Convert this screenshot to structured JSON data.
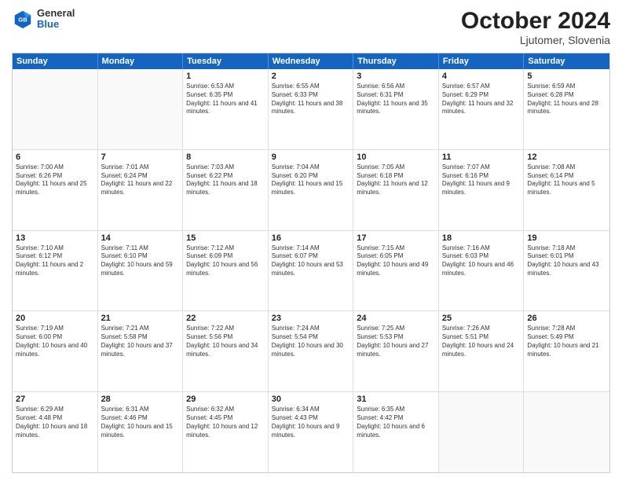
{
  "logo": {
    "general": "General",
    "blue": "Blue"
  },
  "header": {
    "month": "October 2024",
    "location": "Ljutomer, Slovenia"
  },
  "weekdays": [
    "Sunday",
    "Monday",
    "Tuesday",
    "Wednesday",
    "Thursday",
    "Friday",
    "Saturday"
  ],
  "rows": [
    [
      {
        "day": "",
        "sunrise": "",
        "sunset": "",
        "daylight": "",
        "empty": true
      },
      {
        "day": "",
        "sunrise": "",
        "sunset": "",
        "daylight": "",
        "empty": true
      },
      {
        "day": "1",
        "sunrise": "Sunrise: 6:53 AM",
        "sunset": "Sunset: 6:35 PM",
        "daylight": "Daylight: 11 hours and 41 minutes."
      },
      {
        "day": "2",
        "sunrise": "Sunrise: 6:55 AM",
        "sunset": "Sunset: 6:33 PM",
        "daylight": "Daylight: 11 hours and 38 minutes."
      },
      {
        "day": "3",
        "sunrise": "Sunrise: 6:56 AM",
        "sunset": "Sunset: 6:31 PM",
        "daylight": "Daylight: 11 hours and 35 minutes."
      },
      {
        "day": "4",
        "sunrise": "Sunrise: 6:57 AM",
        "sunset": "Sunset: 6:29 PM",
        "daylight": "Daylight: 11 hours and 32 minutes."
      },
      {
        "day": "5",
        "sunrise": "Sunrise: 6:59 AM",
        "sunset": "Sunset: 6:28 PM",
        "daylight": "Daylight: 11 hours and 28 minutes."
      }
    ],
    [
      {
        "day": "6",
        "sunrise": "Sunrise: 7:00 AM",
        "sunset": "Sunset: 6:26 PM",
        "daylight": "Daylight: 11 hours and 25 minutes."
      },
      {
        "day": "7",
        "sunrise": "Sunrise: 7:01 AM",
        "sunset": "Sunset: 6:24 PM",
        "daylight": "Daylight: 11 hours and 22 minutes."
      },
      {
        "day": "8",
        "sunrise": "Sunrise: 7:03 AM",
        "sunset": "Sunset: 6:22 PM",
        "daylight": "Daylight: 11 hours and 18 minutes."
      },
      {
        "day": "9",
        "sunrise": "Sunrise: 7:04 AM",
        "sunset": "Sunset: 6:20 PM",
        "daylight": "Daylight: 11 hours and 15 minutes."
      },
      {
        "day": "10",
        "sunrise": "Sunrise: 7:05 AM",
        "sunset": "Sunset: 6:18 PM",
        "daylight": "Daylight: 11 hours and 12 minutes."
      },
      {
        "day": "11",
        "sunrise": "Sunrise: 7:07 AM",
        "sunset": "Sunset: 6:16 PM",
        "daylight": "Daylight: 11 hours and 9 minutes."
      },
      {
        "day": "12",
        "sunrise": "Sunrise: 7:08 AM",
        "sunset": "Sunset: 6:14 PM",
        "daylight": "Daylight: 11 hours and 5 minutes."
      }
    ],
    [
      {
        "day": "13",
        "sunrise": "Sunrise: 7:10 AM",
        "sunset": "Sunset: 6:12 PM",
        "daylight": "Daylight: 11 hours and 2 minutes."
      },
      {
        "day": "14",
        "sunrise": "Sunrise: 7:11 AM",
        "sunset": "Sunset: 6:10 PM",
        "daylight": "Daylight: 10 hours and 59 minutes."
      },
      {
        "day": "15",
        "sunrise": "Sunrise: 7:12 AM",
        "sunset": "Sunset: 6:09 PM",
        "daylight": "Daylight: 10 hours and 56 minutes."
      },
      {
        "day": "16",
        "sunrise": "Sunrise: 7:14 AM",
        "sunset": "Sunset: 6:07 PM",
        "daylight": "Daylight: 10 hours and 53 minutes."
      },
      {
        "day": "17",
        "sunrise": "Sunrise: 7:15 AM",
        "sunset": "Sunset: 6:05 PM",
        "daylight": "Daylight: 10 hours and 49 minutes."
      },
      {
        "day": "18",
        "sunrise": "Sunrise: 7:16 AM",
        "sunset": "Sunset: 6:03 PM",
        "daylight": "Daylight: 10 hours and 46 minutes."
      },
      {
        "day": "19",
        "sunrise": "Sunrise: 7:18 AM",
        "sunset": "Sunset: 6:01 PM",
        "daylight": "Daylight: 10 hours and 43 minutes."
      }
    ],
    [
      {
        "day": "20",
        "sunrise": "Sunrise: 7:19 AM",
        "sunset": "Sunset: 6:00 PM",
        "daylight": "Daylight: 10 hours and 40 minutes."
      },
      {
        "day": "21",
        "sunrise": "Sunrise: 7:21 AM",
        "sunset": "Sunset: 5:58 PM",
        "daylight": "Daylight: 10 hours and 37 minutes."
      },
      {
        "day": "22",
        "sunrise": "Sunrise: 7:22 AM",
        "sunset": "Sunset: 5:56 PM",
        "daylight": "Daylight: 10 hours and 34 minutes."
      },
      {
        "day": "23",
        "sunrise": "Sunrise: 7:24 AM",
        "sunset": "Sunset: 5:54 PM",
        "daylight": "Daylight: 10 hours and 30 minutes."
      },
      {
        "day": "24",
        "sunrise": "Sunrise: 7:25 AM",
        "sunset": "Sunset: 5:53 PM",
        "daylight": "Daylight: 10 hours and 27 minutes."
      },
      {
        "day": "25",
        "sunrise": "Sunrise: 7:26 AM",
        "sunset": "Sunset: 5:51 PM",
        "daylight": "Daylight: 10 hours and 24 minutes."
      },
      {
        "day": "26",
        "sunrise": "Sunrise: 7:28 AM",
        "sunset": "Sunset: 5:49 PM",
        "daylight": "Daylight: 10 hours and 21 minutes."
      }
    ],
    [
      {
        "day": "27",
        "sunrise": "Sunrise: 6:29 AM",
        "sunset": "Sunset: 4:48 PM",
        "daylight": "Daylight: 10 hours and 18 minutes."
      },
      {
        "day": "28",
        "sunrise": "Sunrise: 6:31 AM",
        "sunset": "Sunset: 4:46 PM",
        "daylight": "Daylight: 10 hours and 15 minutes."
      },
      {
        "day": "29",
        "sunrise": "Sunrise: 6:32 AM",
        "sunset": "Sunset: 4:45 PM",
        "daylight": "Daylight: 10 hours and 12 minutes."
      },
      {
        "day": "30",
        "sunrise": "Sunrise: 6:34 AM",
        "sunset": "Sunset: 4:43 PM",
        "daylight": "Daylight: 10 hours and 9 minutes."
      },
      {
        "day": "31",
        "sunrise": "Sunrise: 6:35 AM",
        "sunset": "Sunset: 4:42 PM",
        "daylight": "Daylight: 10 hours and 6 minutes."
      },
      {
        "day": "",
        "sunrise": "",
        "sunset": "",
        "daylight": "",
        "empty": true
      },
      {
        "day": "",
        "sunrise": "",
        "sunset": "",
        "daylight": "",
        "empty": true
      }
    ]
  ]
}
